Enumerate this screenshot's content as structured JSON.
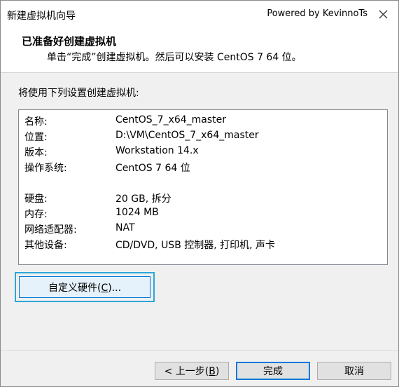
{
  "window": {
    "title": "新建虚拟机向导",
    "brand": "Powered by KevinnoTs",
    "close_icon": "close-icon"
  },
  "header": {
    "title": "已准备好创建虚拟机",
    "subtitle": "单击“完成”创建虚拟机。然后可以安装 CentOS 7 64 位。"
  },
  "body": {
    "section_label": "将使用下列设置创建虚拟机:",
    "settings": [
      {
        "label": "名称:",
        "value": "CentOS_7_x64_master"
      },
      {
        "label": "位置:",
        "value": "D:\\VM\\CentOS_7_x64_master"
      },
      {
        "label": "版本:",
        "value": "Workstation 14.x"
      },
      {
        "label": "操作系统:",
        "value": "CentOS 7 64 位"
      },
      {
        "label": "硬盘:",
        "value": "20 GB, 拆分"
      },
      {
        "label": "内存:",
        "value": "1024 MB"
      },
      {
        "label": "网络适配器:",
        "value": "NAT"
      },
      {
        "label": "其他设备:",
        "value": "CD/DVD, USB 控制器, 打印机, 声卡"
      }
    ],
    "customize": {
      "prefix": "自定义硬件(",
      "mnemonic": "C",
      "suffix": ")..."
    }
  },
  "footer": {
    "back": {
      "prefix": "< 上一步(",
      "mnemonic": "B",
      "suffix": ")"
    },
    "finish": "完成",
    "cancel": "取消"
  },
  "colors": {
    "focus_ring": "#2ba7d8",
    "primary_border": "#0078d7"
  }
}
